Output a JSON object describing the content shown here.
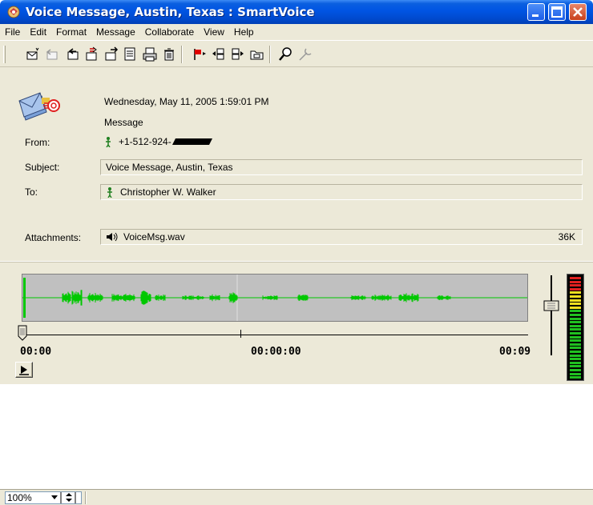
{
  "window": {
    "title": "Voice Message, Austin, Texas : SmartVoice",
    "app_icon": "smartvoice-app-icon",
    "title_bar_color": "#0054e3"
  },
  "menu": [
    "File",
    "Edit",
    "Format",
    "Message",
    "Collaborate",
    "View",
    "Help"
  ],
  "toolbar": {
    "icons": [
      "new-message-icon",
      "reply-icon",
      "reply-all-icon",
      "forward-icon",
      "send-icon",
      "properties-icon",
      "print-icon",
      "delete-icon",
      "flag-icon",
      "previous-icon",
      "next-icon",
      "move-folder-icon",
      "find-icon",
      "tools-icon"
    ]
  },
  "message": {
    "date": "Wednesday, May 11, 2005 1:59:01 PM",
    "type": "Message",
    "from_label": "From:",
    "from_value": "+1-512-924-",
    "subject_label": "Subject:",
    "subject_value": "Voice Message, Austin, Texas",
    "to_label": "To:",
    "to_value": "Christopher W. Walker",
    "attachments_label": "Attachments:",
    "attachment_name": "VoiceMsg.wav",
    "attachment_size": "36K"
  },
  "player": {
    "start_time": "00:00",
    "current_time": "00:00:00",
    "end_time": "00:09",
    "position_fraction": 0.0,
    "volume_fraction": 0.62,
    "waveform_color": "#00c800"
  },
  "status": {
    "zoom": "100%"
  }
}
